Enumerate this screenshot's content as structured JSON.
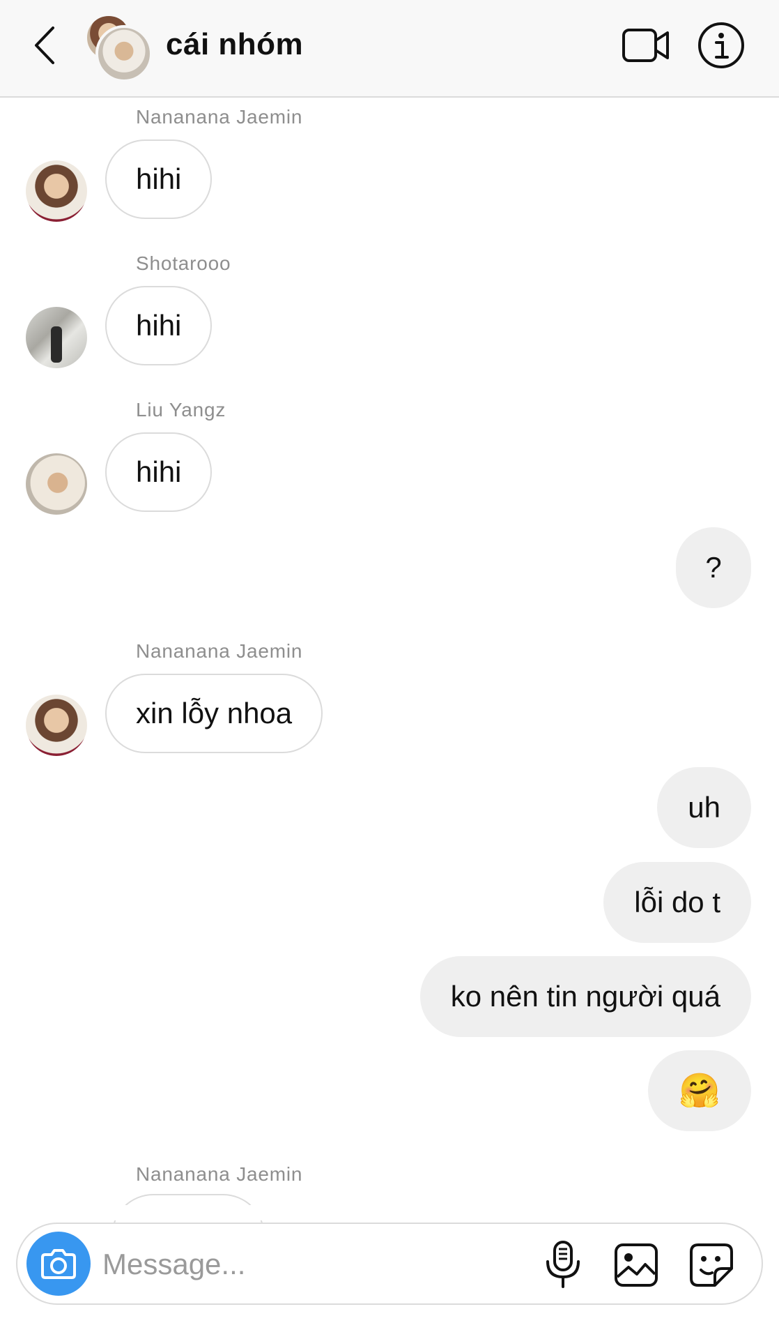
{
  "header": {
    "title": "cái nhóm",
    "icons": {
      "back": "chevron-left-icon",
      "video": "video-call-icon",
      "info": "info-icon"
    }
  },
  "messages": [
    {
      "direction": "in",
      "sender": "Nananana Jaemin",
      "text": "hihi"
    },
    {
      "direction": "in",
      "sender": "Shotarooo",
      "text": "hihi"
    },
    {
      "direction": "in",
      "sender": "Liu Yangz",
      "text": "hihi"
    },
    {
      "direction": "out",
      "text": "?"
    },
    {
      "direction": "in",
      "sender": "Nananana Jaemin",
      "text": "xin lỗy nhoa"
    },
    {
      "direction": "out",
      "text": "uh"
    },
    {
      "direction": "out",
      "text": "lỗi do t"
    },
    {
      "direction": "out",
      "text": "ko nên tin người quá"
    },
    {
      "direction": "out",
      "text": "🤗"
    },
    {
      "direction": "in",
      "sender": "Nananana Jaemin",
      "text": ""
    }
  ],
  "composer": {
    "placeholder": "Message...",
    "value": "",
    "icons": {
      "camera": "camera-icon",
      "mic": "microphone-icon",
      "gallery": "gallery-icon",
      "sticker": "sticker-icon"
    }
  },
  "colors": {
    "accent": "#3897f0",
    "outgoing_bubble": "#efefef",
    "border": "#dbdbdb",
    "meta_text": "#8e8e8e"
  }
}
